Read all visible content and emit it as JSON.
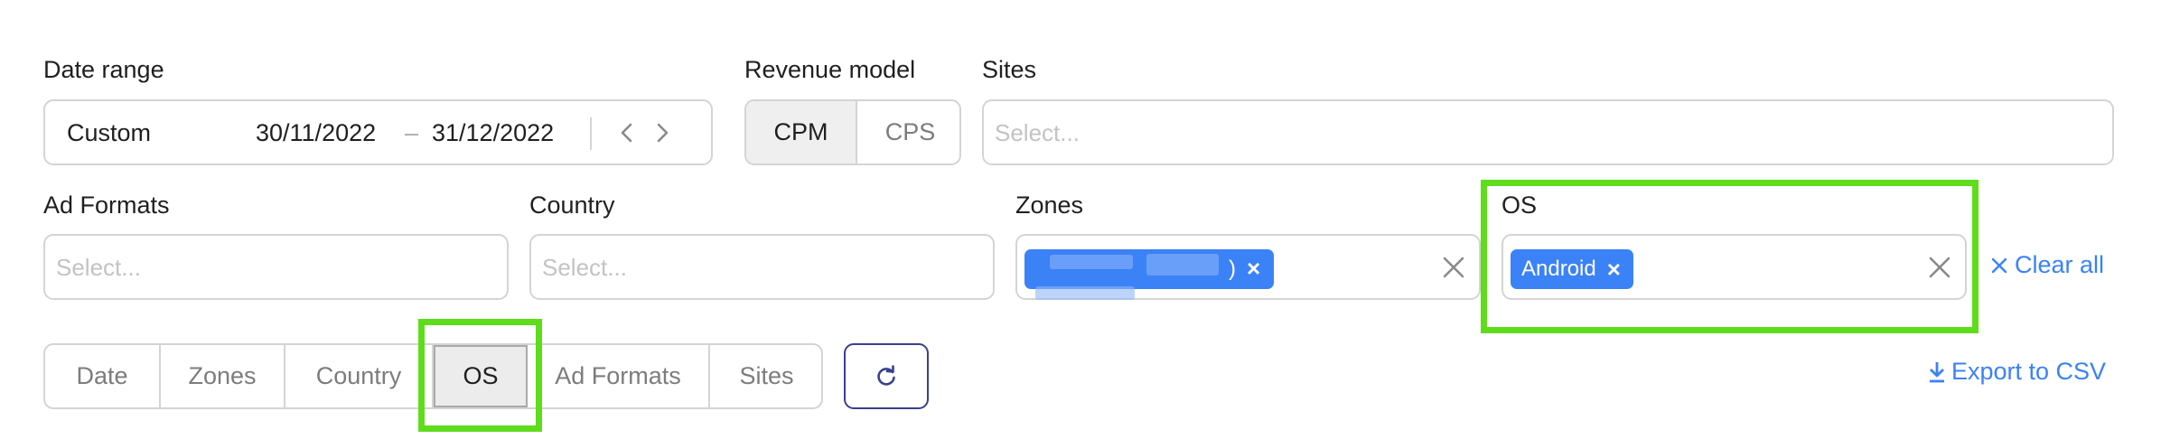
{
  "filters": {
    "date_range": {
      "label": "Date range",
      "preset": "Custom",
      "start": "30/11/2022",
      "dash": "–",
      "end": "31/12/2022"
    },
    "revenue_model": {
      "label": "Revenue model",
      "options": [
        "CPM",
        "CPS"
      ],
      "selected": "CPM"
    },
    "sites": {
      "label": "Sites",
      "placeholder": "Select..."
    },
    "ad_formats": {
      "label": "Ad Formats",
      "placeholder": "Select..."
    },
    "country": {
      "label": "Country",
      "placeholder": "Select..."
    },
    "zones": {
      "label": "Zones",
      "chip_suffix": ")"
    },
    "os": {
      "label": "OS",
      "chips": [
        "Android"
      ]
    },
    "clear_all": "Clear all"
  },
  "group_by": {
    "tabs": [
      "Date",
      "Zones",
      "Country",
      "OS",
      "Ad Formats",
      "Sites"
    ],
    "active": "OS"
  },
  "actions": {
    "export_csv": "Export to CSV"
  },
  "colors": {
    "accent": "#3b82f6",
    "highlight": "#5fdc1c",
    "refresh_border": "#3a3f8f"
  },
  "icons": {
    "prev": "chevron-left-icon",
    "next": "chevron-right-icon",
    "clear": "close-icon",
    "refresh": "refresh-icon",
    "download": "download-icon"
  }
}
